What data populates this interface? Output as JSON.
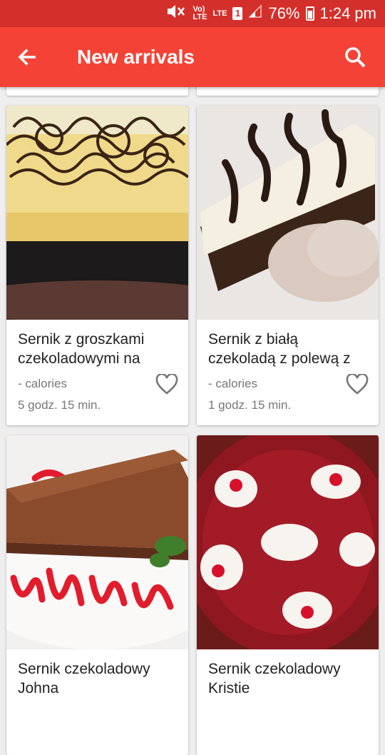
{
  "status_bar": {
    "volte": "Vo)\nLTE",
    "lte": "LTE",
    "sim": "1",
    "battery": "76%",
    "time": "1:24 pm"
  },
  "app_bar": {
    "title": "New arrivals",
    "back_icon": "arrow-back-icon",
    "search_icon": "search-icon"
  },
  "colors": {
    "primary": "#f44336",
    "status_bar": "#d4302b"
  },
  "recipes": [
    {
      "name": "Sernik z groszkami czekoladowymi na",
      "calories": "- calories",
      "time": "5 godz. 15 min.",
      "image": "cheesecake-chocolate-drizzle"
    },
    {
      "name": "Sernik z białą czekoladą z polewą z",
      "calories": "- calories",
      "time": "1 godz. 15 min.",
      "image": "white-chocolate-cheesecake-slice"
    },
    {
      "name": "Sernik czekoladowy Johna",
      "calories": "",
      "time": "",
      "image": "chocolate-cheesecake-slice"
    },
    {
      "name": "Sernik czekoladowy Kristie",
      "calories": "",
      "time": "",
      "image": "cheesecake-cherry-topping"
    }
  ]
}
